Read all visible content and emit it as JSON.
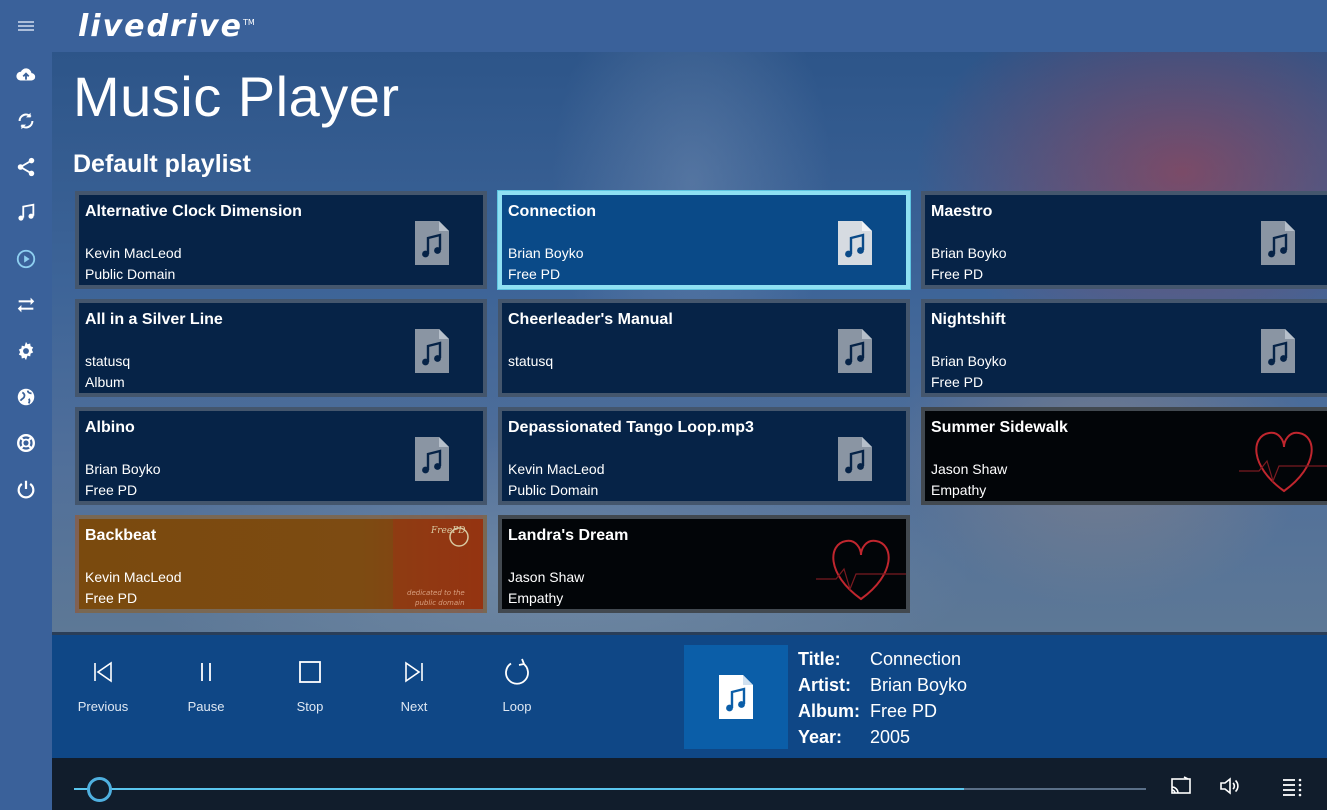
{
  "app": {
    "logo": "livedrive",
    "logo_tm": "TM"
  },
  "page": {
    "title": "Music Player",
    "playlist": "Default playlist"
  },
  "sidebar": {
    "items": [
      {
        "icon": "menu-icon"
      },
      {
        "icon": "cloud-upload-icon"
      },
      {
        "icon": "sync-icon"
      },
      {
        "icon": "share-icon"
      },
      {
        "icon": "music-note-icon"
      },
      {
        "icon": "play-circle-icon"
      },
      {
        "icon": "transfer-icon"
      },
      {
        "icon": "gear-icon"
      },
      {
        "icon": "globe-icon"
      },
      {
        "icon": "lifebuoy-icon"
      },
      {
        "icon": "power-icon"
      }
    ]
  },
  "tracks": [
    {
      "title": "Alternative Clock Dimension",
      "artist": "Kevin MacLeod",
      "album": "Public Domain"
    },
    {
      "title": "Connection",
      "artist": "Brian Boyko",
      "album": "Free PD",
      "selected": true
    },
    {
      "title": "Maestro",
      "artist": "Brian Boyko",
      "album": "Free PD"
    },
    {
      "title": "All in a Silver Line",
      "artist": "statusq",
      "album": "Album"
    },
    {
      "title": "Cheerleader's Manual",
      "artist": "statusq",
      "album": ""
    },
    {
      "title": "Nightshift",
      "artist": "Brian Boyko",
      "album": "Free PD"
    },
    {
      "title": "Albino",
      "artist": "Brian Boyko",
      "album": "Free PD"
    },
    {
      "title": "Depassionated Tango Loop.mp3",
      "artist": "Kevin MacLeod",
      "album": "Public Domain"
    },
    {
      "title": "Summer Sidewalk",
      "artist": "Jason Shaw",
      "album": "Empathy"
    },
    {
      "title": "Backbeat",
      "artist": "Kevin MacLeod",
      "album": "Free PD"
    },
    {
      "title": "Landra's Dream",
      "artist": "Jason Shaw",
      "album": "Empathy"
    }
  ],
  "controls": {
    "previous": "Previous",
    "pause": "Pause",
    "stop": "Stop",
    "next": "Next",
    "loop": "Loop"
  },
  "now_playing": {
    "title_label": "Title:",
    "title": "Connection",
    "artist_label": "Artist:",
    "artist": "Brian Boyko",
    "album_label": "Album:",
    "album": "Free PD",
    "year_label": "Year:",
    "year": "2005"
  },
  "playback": {
    "progress": 0.02,
    "buffered": 0.83
  },
  "colors": {
    "accent": "#5bc6ee",
    "selected_border": "#8fe0f2",
    "sidebar": "#3a619a"
  }
}
